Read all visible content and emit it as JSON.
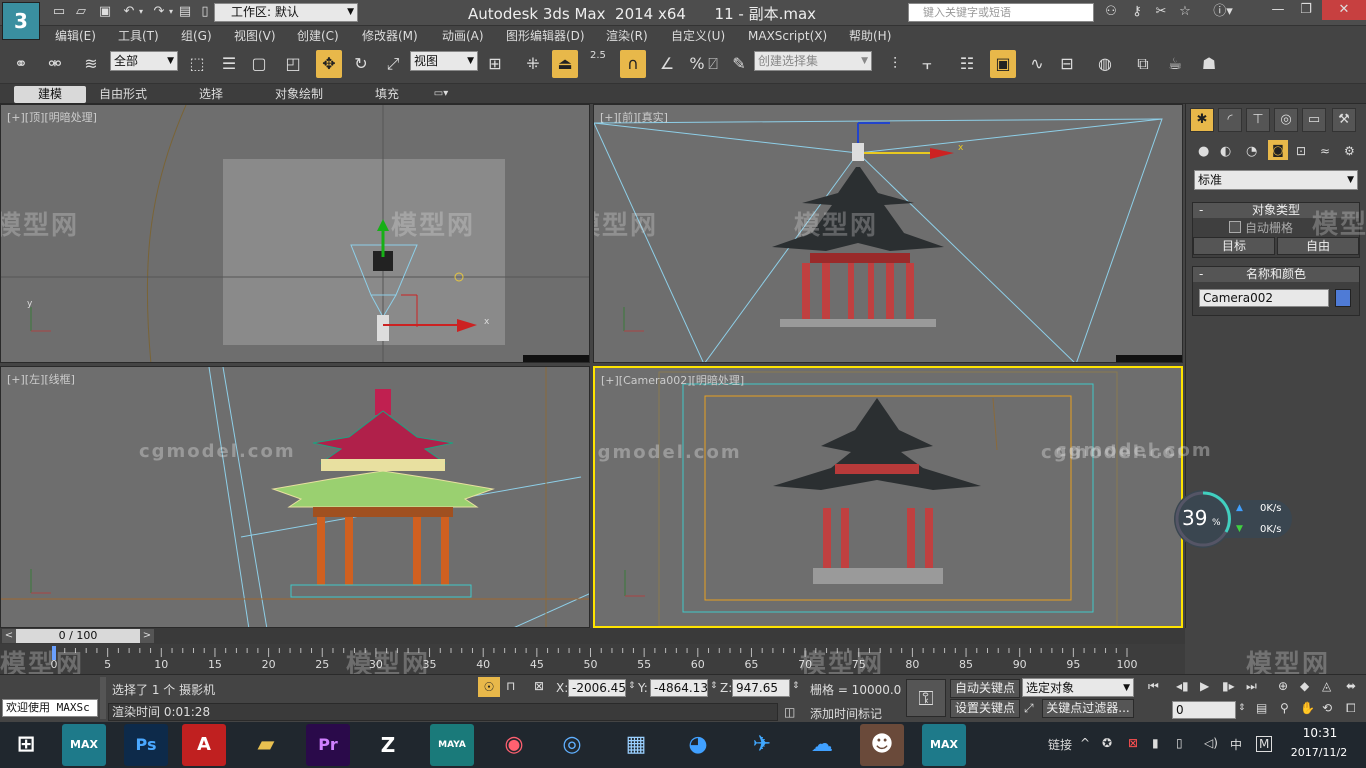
{
  "titlebar": {
    "workspace_label": "工作区: 默认",
    "app_title": "Autodesk 3ds Max  2014 x64      11 - 副本.max",
    "search_placeholder": "键入关键字或短语",
    "logo_text": "3"
  },
  "menu": [
    "编辑(E)",
    "工具(T)",
    "组(G)",
    "视图(V)",
    "创建(C)",
    "修改器(M)",
    "动画(A)",
    "图形编辑器(D)",
    "渲染(R)",
    "自定义(U)",
    "MAXScript(X)",
    "帮助(H)"
  ],
  "toolbar": {
    "selection_filter": "全部",
    "ref_coord": "视图",
    "named_selection": "创建选择集",
    "snap_value": "2.5"
  },
  "ribbon_tabs": [
    "建模",
    "自由形式",
    "选择",
    "对象绘制",
    "填充"
  ],
  "viewports": {
    "top": "[+][顶][明暗处理]",
    "front": "[+][前][真实]",
    "left": "[+][左][线框]",
    "camera": "[+][Camera002][明暗处理]"
  },
  "watermarks": {
    "cn": "模型网",
    "en": "cgmodel.com"
  },
  "command_panel": {
    "category": "标准",
    "object_type_title": "对象类型",
    "autogrid_label": "自动栅格",
    "btn_target": "目标",
    "btn_free": "自由",
    "name_color_title": "名称和颜色",
    "object_name": "Camera002",
    "object_color": "#4f7bd6"
  },
  "timeline": {
    "frame_display": "0 / 100",
    "ticks": [
      "0",
      "5",
      "10",
      "15",
      "20",
      "25",
      "30",
      "35",
      "40",
      "45",
      "50",
      "55",
      "60",
      "65",
      "70",
      "75",
      "80",
      "85",
      "90",
      "95",
      "100"
    ]
  },
  "status": {
    "script_listener": "欢迎使用 MAXSc",
    "selection_msg": "选择了 1 个 摄影机",
    "render_time": "渲染时间  0:01:28",
    "x_label": "X:",
    "x_value": "-2006.455",
    "y_label": "Y:",
    "y_value": "-4864.134",
    "z_label": "Z:",
    "z_value": "947.65",
    "grid": "栅格 = 10000.0",
    "add_time_tag": "添加时间标记",
    "auto_key": "自动关键点",
    "set_key": "设置关键点",
    "key_mode": "选定对象",
    "key_filters": "关键点过滤器...",
    "frame_field": "0"
  },
  "net_widget": {
    "percent": "39",
    "percent_sign": "%",
    "up_speed": "0K/s",
    "down_speed": "0K/s"
  },
  "taskbar": {
    "apps": [
      {
        "name": "windows-start",
        "label": ""
      },
      {
        "name": "3dsmax",
        "label": "MAX"
      },
      {
        "name": "photoshop",
        "label": "Ps"
      },
      {
        "name": "autocad",
        "label": "A"
      },
      {
        "name": "file-explorer",
        "label": ""
      },
      {
        "name": "premiere",
        "label": "Pr"
      },
      {
        "name": "zbrush",
        "label": "Z"
      },
      {
        "name": "maya",
        "label": "MAYA"
      },
      {
        "name": "camera-app",
        "label": ""
      },
      {
        "name": "browser",
        "label": ""
      },
      {
        "name": "calculator",
        "label": ""
      },
      {
        "name": "video-app",
        "label": ""
      },
      {
        "name": "feishu",
        "label": ""
      },
      {
        "name": "cloud-app",
        "label": ""
      },
      {
        "name": "game-app",
        "label": ""
      },
      {
        "name": "3dsmax-2",
        "label": "MAX"
      }
    ],
    "link_label": "链接",
    "ime": "中",
    "ime2": "M",
    "time": "10:31",
    "date": "2017/11/2"
  }
}
